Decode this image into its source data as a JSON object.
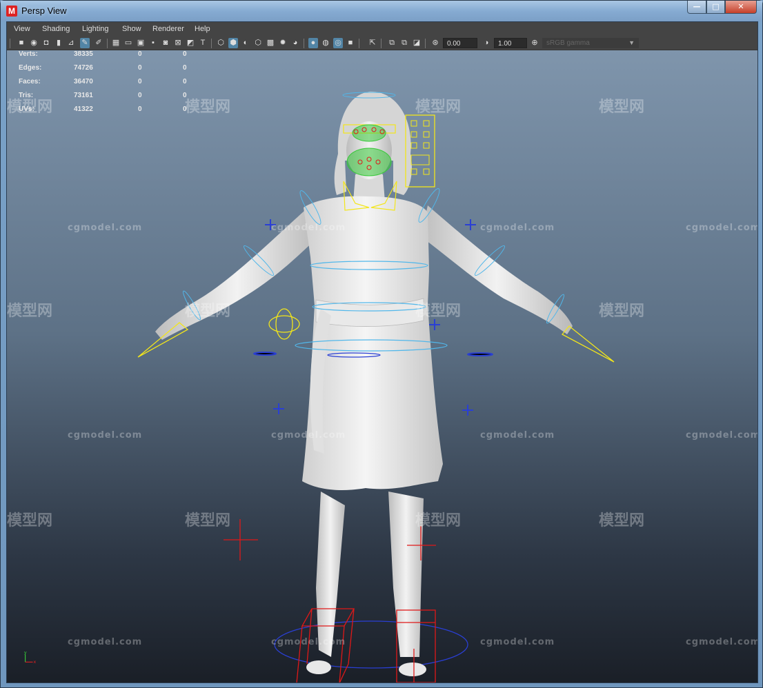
{
  "window": {
    "app_icon_letter": "M",
    "title": "Persp View",
    "controls": {
      "minimize": "—",
      "maximize": "□",
      "close": "✕"
    }
  },
  "menu": [
    "View",
    "Shading",
    "Lighting",
    "Show",
    "Renderer",
    "Help"
  ],
  "toolbar": {
    "exposure_value": "0.00",
    "gamma_value": "1.00",
    "color_space": "sRGB gamma"
  },
  "hud": [
    {
      "label": "Verts:",
      "v1": "38335",
      "v2": "0",
      "v3": "0"
    },
    {
      "label": "Edges:",
      "v1": "74726",
      "v2": "0",
      "v3": "0"
    },
    {
      "label": "Faces:",
      "v1": "36470",
      "v2": "0",
      "v3": "0"
    },
    {
      "label": "Tris:",
      "v1": "73161",
      "v2": "0",
      "v3": "0"
    },
    {
      "label": "UVs:",
      "v1": "41322",
      "v2": "0",
      "v3": "0"
    }
  ],
  "watermarks": {
    "url": "cgmodel.com",
    "brand": "模型网"
  },
  "axis": {
    "y": "y",
    "x": "x"
  },
  "colors": {
    "ctrl_yellow": "#f3e61a",
    "ctrl_blue": "#51b7ea",
    "ctrl_darkblue": "#2a3fd4",
    "ctrl_red": "#e01818",
    "ctrl_green": "#38c83a"
  }
}
